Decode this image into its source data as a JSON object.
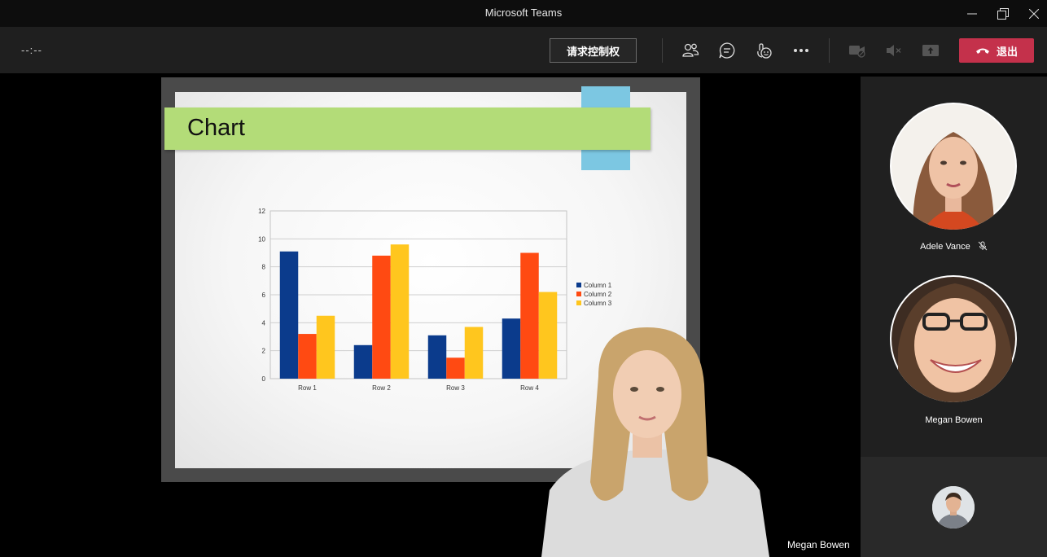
{
  "window": {
    "title": "Microsoft Teams"
  },
  "toolbar": {
    "timer": "--:--",
    "request_control_label": "请求控制权",
    "leave_label": "退出"
  },
  "slide": {
    "title": "Chart"
  },
  "chart_data": {
    "type": "bar",
    "categories": [
      "Row 1",
      "Row 2",
      "Row 3",
      "Row 4"
    ],
    "series": [
      {
        "name": "Column 1",
        "color": "#0b3b8c",
        "values": [
          9.1,
          2.4,
          3.1,
          4.3
        ]
      },
      {
        "name": "Column 2",
        "color": "#ff4a12",
        "values": [
          3.2,
          8.8,
          1.5,
          9.0
        ]
      },
      {
        "name": "Column 3",
        "color": "#ffc61e",
        "values": [
          4.5,
          9.6,
          3.7,
          6.2
        ]
      }
    ],
    "yticks": [
      "0",
      "2",
      "4",
      "6",
      "8",
      "10",
      "12"
    ],
    "ylim": [
      0,
      12
    ],
    "grid": true,
    "legend": "right"
  },
  "stage": {
    "presenter_name": "Megan Bowen"
  },
  "participants": [
    {
      "name": "Adele Vance",
      "muted": true
    },
    {
      "name": "Megan Bowen",
      "muted": false
    }
  ],
  "icons": [
    "minimize-icon",
    "restore-icon",
    "close-icon",
    "participants-icon",
    "chat-icon",
    "reactions-icon",
    "more-icon",
    "camera-off-icon",
    "speaker-mute-icon",
    "share-icon",
    "hangup-icon",
    "mic-muted-icon"
  ]
}
